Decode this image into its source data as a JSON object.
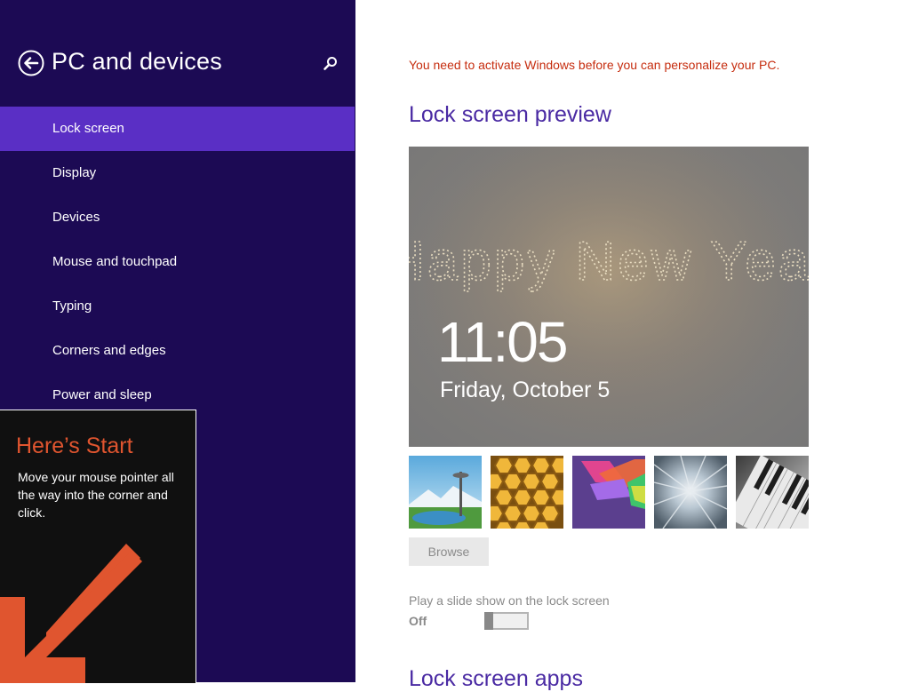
{
  "colors": {
    "pane_bg": "#1c0a54",
    "selected_bg": "#5a2fc5",
    "heading": "#4a2aa3",
    "warning": "#c62d0f",
    "tip_accent": "#e0552f"
  },
  "left_pane": {
    "back_icon": "back-arrow-icon",
    "title": "PC and devices",
    "search_icon": "search-icon",
    "selected_index": 0,
    "items": [
      {
        "label": "Lock screen"
      },
      {
        "label": "Display"
      },
      {
        "label": "Devices"
      },
      {
        "label": "Mouse and touchpad"
      },
      {
        "label": "Typing"
      },
      {
        "label": "Corners and edges"
      },
      {
        "label": "Power and sleep"
      }
    ]
  },
  "start_tip": {
    "title": "Here’s Start",
    "body": "Move your mouse pointer all the way into the corner and click.",
    "arrow_icon": "arrow-down-left-icon"
  },
  "main": {
    "activation_message": "You need to activate Windows before you can personalize your PC.",
    "preview_heading": "Lock screen preview",
    "preview": {
      "image_text": "Happy New Year",
      "time": "11:05",
      "date": "Friday, October 5"
    },
    "thumbnails": [
      {
        "name": "space-needle"
      },
      {
        "name": "honeycomb"
      },
      {
        "name": "colored-shapes"
      },
      {
        "name": "motion-blur"
      },
      {
        "name": "piano-keys"
      }
    ],
    "browse_label": "Browse",
    "slideshow": {
      "label": "Play a slide show on the lock screen",
      "state_label": "Off",
      "on": false
    },
    "apps_heading": "Lock screen apps"
  }
}
